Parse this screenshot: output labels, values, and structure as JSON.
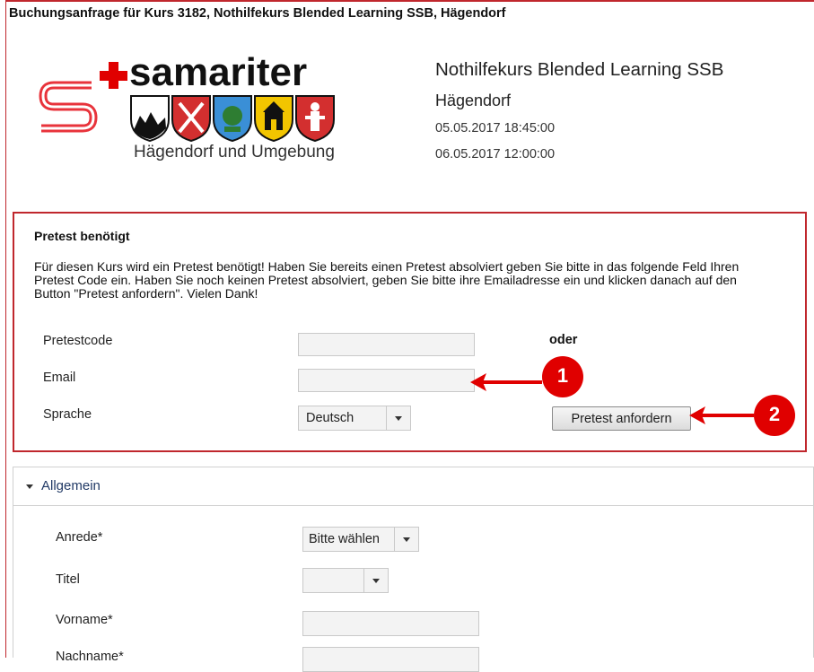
{
  "page": {
    "heading": "Buchungsanfrage für Kurs 3182, Nothilfekurs Blended Learning SSB, Hägendorf"
  },
  "logo": {
    "brand": "samariter",
    "subtitle": "Hägendorf und Umgebung"
  },
  "course": {
    "title": "Nothilfekurs Blended Learning SSB",
    "location": "Hägendorf",
    "start": "05.05.2017 18:45:00",
    "end": "06.05.2017 12:00:00"
  },
  "pretest": {
    "title": "Pretest benötigt",
    "text": "Für diesen Kurs wird ein Pretest benötigt! Haben Sie bereits einen Pretest absolviert geben Sie bitte in das folgende Feld Ihren Pretest Code ein. Haben Sie noch keinen Pretest absolviert, geben Sie bitte ihre Emailadresse ein und klicken danach auf den Button \"Pretest anfordern\". Vielen Dank!",
    "code_label": "Pretestcode",
    "code_value": "",
    "or_label": "oder",
    "email_label": "Email",
    "email_value": "",
    "language_label": "Sprache",
    "language_value": "Deutsch",
    "button_label": "Pretest anfordern"
  },
  "annotations": {
    "marker_1": "1",
    "marker_2": "2",
    "color": "#e00000"
  },
  "allgemein": {
    "title": "Allgemein",
    "anrede_label": "Anrede*",
    "anrede_value": "Bitte wählen",
    "titel_label": "Titel",
    "titel_value": "",
    "vorname_label": "Vorname*",
    "vorname_value": "",
    "nachname_label": "Nachname*",
    "nachname_value": ""
  },
  "colors": {
    "accent": "#c0272d",
    "section_title": "#223a66"
  }
}
